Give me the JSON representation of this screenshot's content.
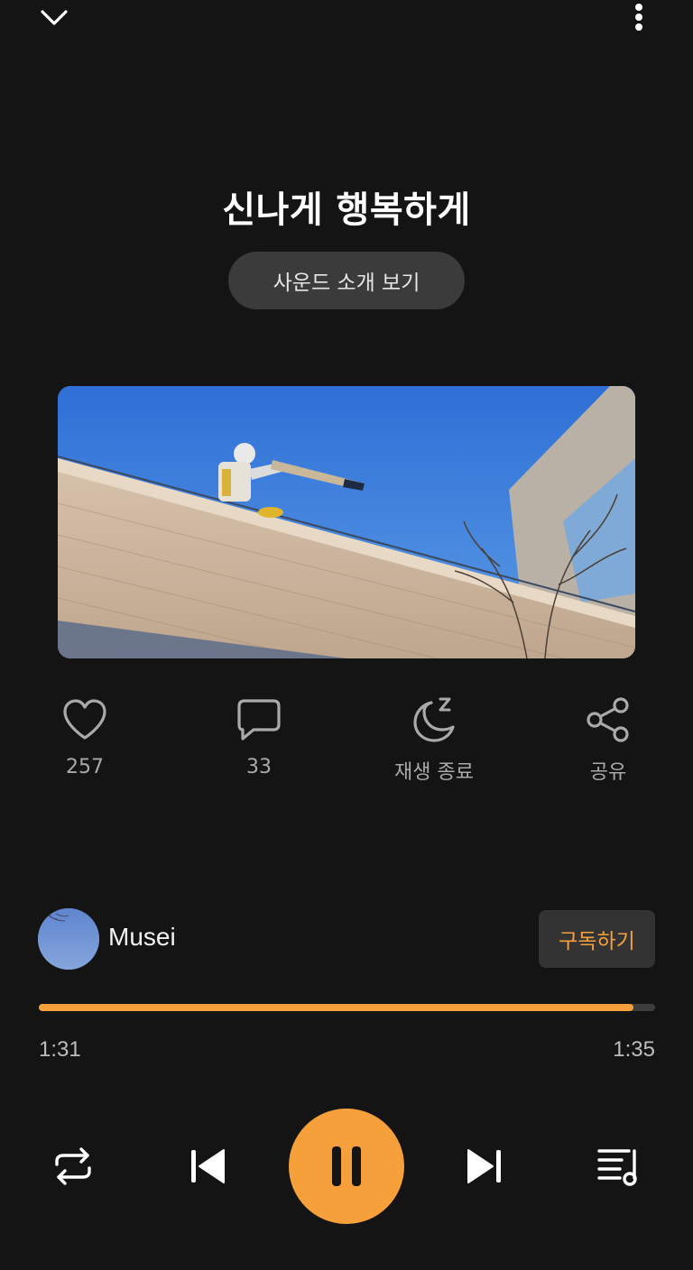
{
  "header": {
    "collapse_icon": "chevron-down-icon",
    "more_icon": "more-vertical-icon"
  },
  "track": {
    "title": "신나게 행복하게",
    "intro_button": "사운드 소개 보기"
  },
  "actions": {
    "like": {
      "icon": "heart-icon",
      "label": "257"
    },
    "comment": {
      "icon": "comment-icon",
      "label": "33"
    },
    "sleep_timer": {
      "icon": "moon-sleep-icon",
      "label": "재생 종료"
    },
    "share": {
      "icon": "share-icon",
      "label": "공유"
    }
  },
  "creator": {
    "name": "Musei",
    "subscribe_label": "구독하기"
  },
  "player": {
    "current_time": "1:31",
    "total_time": "1:35",
    "progress_fraction": 0.965,
    "controls": {
      "repeat_icon": "repeat-icon",
      "previous_icon": "skip-previous-icon",
      "pause_icon": "pause-icon",
      "next_icon": "skip-next-icon",
      "playlist_icon": "playlist-icon"
    }
  },
  "colors": {
    "accent": "#f5a03a",
    "background": "#141414",
    "muted_text": "#a9a9a9"
  }
}
